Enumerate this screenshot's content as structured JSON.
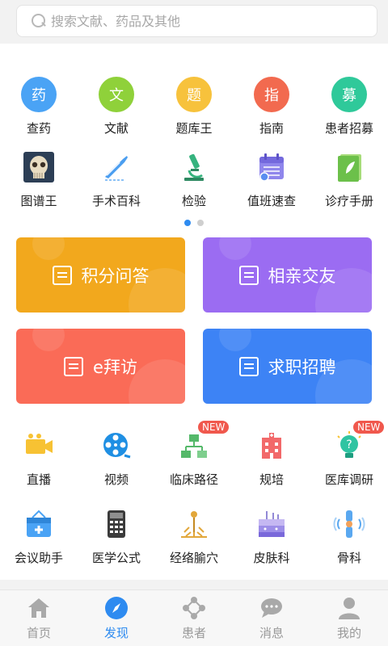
{
  "search": {
    "placeholder": "搜索文献、药品及其他"
  },
  "grid_row1": [
    {
      "label": "查药",
      "badge": "药",
      "color": "#4aa3f5"
    },
    {
      "label": "文献",
      "badge": "文",
      "color": "#8fd13a"
    },
    {
      "label": "题库王",
      "badge": "题",
      "color": "#f7c23c"
    },
    {
      "label": "指南",
      "badge": "指",
      "color": "#f26a4f"
    },
    {
      "label": "患者招募",
      "badge": "募",
      "color": "#2fc99a"
    }
  ],
  "grid_row2": [
    {
      "label": "图谱王"
    },
    {
      "label": "手术百科"
    },
    {
      "label": "检验"
    },
    {
      "label": "值班速查"
    },
    {
      "label": "诊疗手册"
    }
  ],
  "cards": [
    {
      "label": "积分问答",
      "color": "#f2a81d"
    },
    {
      "label": "相亲交友",
      "color": "#9b6cf2"
    },
    {
      "label": "e拜访",
      "color": "#fa6b57"
    },
    {
      "label": "求职招聘",
      "color": "#3d83f5"
    }
  ],
  "grid_row3": [
    {
      "label": "直播"
    },
    {
      "label": "视频"
    },
    {
      "label": "临床路径",
      "tag": "NEW"
    },
    {
      "label": "规培"
    },
    {
      "label": "医库调研",
      "tag": "NEW"
    }
  ],
  "grid_row4": [
    {
      "label": "会议助手"
    },
    {
      "label": "医学公式"
    },
    {
      "label": "经络腧穴"
    },
    {
      "label": "皮肤科"
    },
    {
      "label": "骨科"
    }
  ],
  "pager": {
    "pages": 2,
    "active": 1
  },
  "tabs": [
    {
      "label": "首页"
    },
    {
      "label": "发现"
    },
    {
      "label": "患者"
    },
    {
      "label": "消息"
    },
    {
      "label": "我的"
    }
  ]
}
